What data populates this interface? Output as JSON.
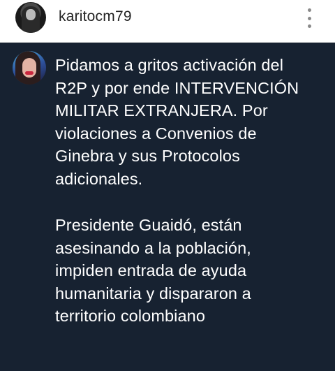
{
  "header": {
    "username": "karitocm79",
    "more_icon": "more-vertical-icon"
  },
  "comment": {
    "paragraphs": [
      [
        "Pidamos a gritos activación del",
        "R2P y por ende INTERVENCIÓN",
        "MILITAR EXTRANJERA. Por",
        "violaciones a Convenios de",
        "Ginebra y sus Protocolos",
        "adicionales."
      ],
      [
        "Presidente Guaidó, están",
        "asesinando a la población,",
        "impiden entrada de ayuda",
        "humanitaria y dispararon a",
        "territorio colombiano"
      ]
    ]
  },
  "colors": {
    "header_bg": "#ffffff",
    "panel_bg": "#172231",
    "text": "#ffffff"
  }
}
